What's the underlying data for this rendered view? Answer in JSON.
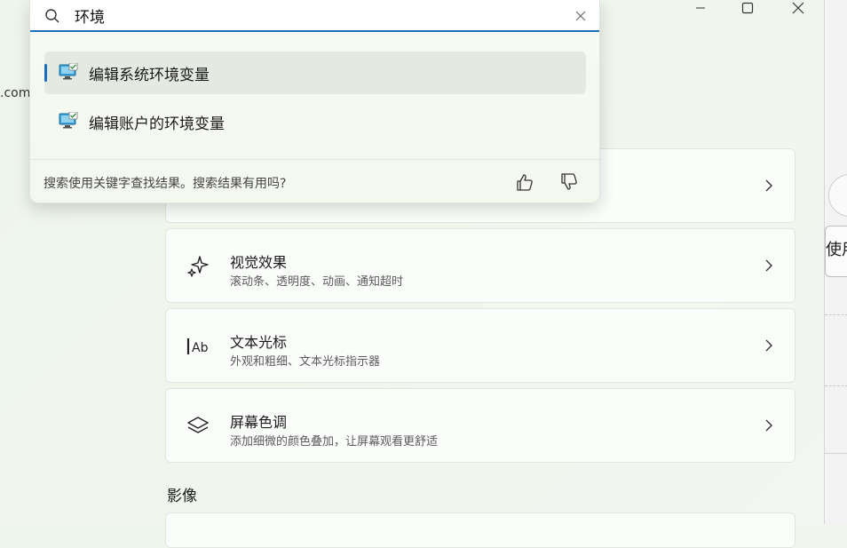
{
  "search": {
    "query": "环境",
    "results": [
      {
        "label": "编辑系统环境变量",
        "selected": true
      },
      {
        "label": "编辑账户的环境变量",
        "selected": false
      }
    ],
    "feedback_text": "搜索使用关键字查找结果。搜索结果有用吗?"
  },
  "background": {
    "left_fragment": ".com",
    "right_button_label": "使用"
  },
  "cards": [
    {
      "title": "视觉效果",
      "subtitle": "滚动条、透明度、动画、通知超时",
      "icon": "sparkle-icon"
    },
    {
      "title": "文本光标",
      "subtitle": "外观和粗细、文本光标指示器",
      "icon": "text-cursor-icon"
    },
    {
      "title": "屏幕色调",
      "subtitle": "添加细微的颜色叠加，让屏幕观看更舒适",
      "icon": "layers-icon"
    }
  ],
  "section": {
    "label": "影像"
  },
  "colors": {
    "accent": "#1a6ec0"
  }
}
